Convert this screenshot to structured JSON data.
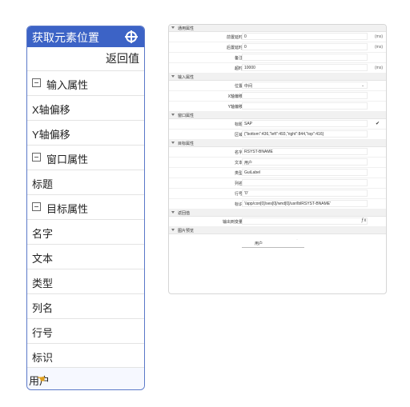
{
  "node_card": {
    "title": "获取元素位置",
    "return_label": "返回值",
    "rows": [
      {
        "label": "输入属性",
        "group": true
      },
      {
        "label": "X轴偏移",
        "group": false
      },
      {
        "label": "Y轴偏移",
        "group": false
      },
      {
        "label": "窗口属性",
        "group": true
      },
      {
        "label": "标题",
        "group": false
      },
      {
        "label": "目标属性",
        "group": true
      },
      {
        "label": "名字",
        "group": false
      },
      {
        "label": "文本",
        "group": false
      },
      {
        "label": "类型",
        "group": false
      },
      {
        "label": "列名",
        "group": false
      },
      {
        "label": "行号",
        "group": false
      },
      {
        "label": "标识",
        "group": false
      }
    ],
    "bottom_label": "用户"
  },
  "panel": {
    "general": {
      "header": "通用属性",
      "fields": [
        {
          "key": "前置延时",
          "value": "0",
          "unit": "(ms)"
        },
        {
          "key": "后置延时",
          "value": "0",
          "unit": "(ms)"
        },
        {
          "key": "备注",
          "value": "",
          "unit": ""
        },
        {
          "key": "超时",
          "value": "10000",
          "unit": "(ms)"
        }
      ]
    },
    "input": {
      "header": "输入属性",
      "fields": [
        {
          "key": "位置",
          "value": "中间"
        },
        {
          "key": "X轴偏移",
          "value": ""
        },
        {
          "key": "Y轴偏移",
          "value": ""
        }
      ]
    },
    "window": {
      "header": "窗口属性",
      "fields": [
        {
          "key": "标题",
          "value": "SAP"
        },
        {
          "key": "区域",
          "value": "{\"bottom\":436,\"left\":493,\"right\":844,\"top\":416}"
        }
      ]
    },
    "target": {
      "header": "目标属性",
      "fields": [
        {
          "key": "名字",
          "value": "RSYST-BNAME"
        },
        {
          "key": "文本",
          "value": "用户"
        },
        {
          "key": "类型",
          "value": "GuiLabel"
        },
        {
          "key": "列名",
          "value": ""
        },
        {
          "key": "行号",
          "value": "'0'"
        },
        {
          "key": "标识",
          "value": "'/app/con[0]/ses[0]/wnd[0]/usr/lblRSYST-BNAME'"
        }
      ]
    },
    "return": {
      "header": "返回值",
      "fields": [
        {
          "key": "输出到变量",
          "value": ""
        }
      ]
    },
    "preview": {
      "header": "图片预览",
      "value": "用户"
    }
  },
  "icons": {
    "crosshair": "crosshair-icon",
    "collapse": "minus-box-icon",
    "section_toggle": "caret-down-icon",
    "dropdown": "chevron-down-icon",
    "check": "check-icon",
    "function": "fx-icon",
    "hand_cursor": "hand-cursor-icon"
  }
}
